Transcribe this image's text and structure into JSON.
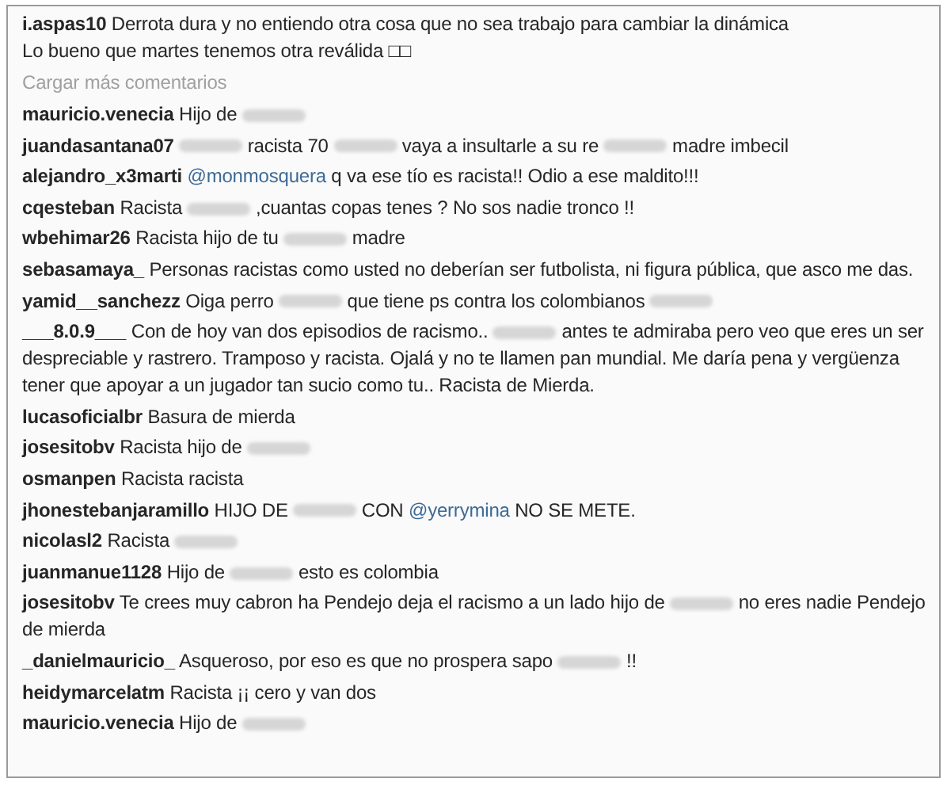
{
  "comments": [
    {
      "username": "i.aspas10",
      "segments": [
        {
          "kind": "text",
          "text": "Derrota dura y no entiendo otra cosa que no sea trabajo para cambiar la dinámica"
        },
        {
          "kind": "break"
        },
        {
          "kind": "text",
          "text": "Lo bueno que martes tenemos otra reválida □□"
        }
      ]
    },
    {
      "kind": "load_more",
      "text": "Cargar más comentarios"
    },
    {
      "username": "mauricio.venecia",
      "segments": [
        {
          "kind": "text",
          "text": "Hijo de"
        },
        {
          "kind": "censored"
        }
      ]
    },
    {
      "username": "juandasantana07",
      "segments": [
        {
          "kind": "censored"
        },
        {
          "kind": "text",
          "text": "racista 70"
        },
        {
          "kind": "censored"
        },
        {
          "kind": "text",
          "text": "vaya a insultarle a su re"
        },
        {
          "kind": "censored"
        },
        {
          "kind": "text",
          "text": "madre imbecil"
        }
      ]
    },
    {
      "username": "alejandro_x3marti",
      "segments": [
        {
          "kind": "mention",
          "text": "@monmosquera"
        },
        {
          "kind": "text",
          "text": "q va ese tío es racista!! Odio a ese maldito!!!"
        }
      ]
    },
    {
      "username": "cqesteban",
      "segments": [
        {
          "kind": "text",
          "text": "Racista"
        },
        {
          "kind": "censored"
        },
        {
          "kind": "text",
          "text": ",cuantas copas tenes ? No sos nadie tronco !!"
        }
      ]
    },
    {
      "username": "wbehimar26",
      "segments": [
        {
          "kind": "text",
          "text": "Racista hijo de tu"
        },
        {
          "kind": "censored"
        },
        {
          "kind": "text",
          "text": "madre"
        }
      ]
    },
    {
      "username": "sebasamaya_",
      "segments": [
        {
          "kind": "text",
          "text": "Personas racistas como usted no deberían ser futbolista, ni figura pública, que asco me das."
        }
      ]
    },
    {
      "username": "yamid__sanchezz",
      "segments": [
        {
          "kind": "text",
          "text": "Oiga perro"
        },
        {
          "kind": "censored"
        },
        {
          "kind": "text",
          "text": "que tiene ps contra los colombianos"
        },
        {
          "kind": "censored"
        }
      ]
    },
    {
      "username": "___8.0.9___",
      "segments": [
        {
          "kind": "text",
          "text": "Con de hoy van dos episodios de racismo.."
        },
        {
          "kind": "censored"
        },
        {
          "kind": "text",
          "text": "antes te admiraba pero veo que eres un ser despreciable y rastrero. Tramposo y racista. Ojalá y no te llamen pan mundial. Me daría pena y vergüenza tener que apoyar a un jugador tan sucio como tu.. Racista de Mierda."
        }
      ]
    },
    {
      "username": "lucasoficialbr",
      "segments": [
        {
          "kind": "text",
          "text": "Basura de mierda"
        }
      ]
    },
    {
      "username": "josesitobv",
      "segments": [
        {
          "kind": "text",
          "text": "Racista hijo de"
        },
        {
          "kind": "censored"
        }
      ]
    },
    {
      "username": "osmanpen",
      "segments": [
        {
          "kind": "text",
          "text": "Racista racista"
        }
      ]
    },
    {
      "username": "jhonestebanjaramillo",
      "segments": [
        {
          "kind": "text",
          "text": "HIJO DE"
        },
        {
          "kind": "censored"
        },
        {
          "kind": "text",
          "text": "CON"
        },
        {
          "kind": "mention",
          "text": "@yerrymina"
        },
        {
          "kind": "text",
          "text": "NO SE METE."
        }
      ]
    },
    {
      "username": "nicolasl2",
      "segments": [
        {
          "kind": "text",
          "text": "Racista"
        },
        {
          "kind": "censored"
        }
      ]
    },
    {
      "username": "juanmanue1128",
      "segments": [
        {
          "kind": "text",
          "text": "Hijo de"
        },
        {
          "kind": "censored"
        },
        {
          "kind": "text",
          "text": "esto es colombia"
        }
      ]
    },
    {
      "username": "josesitobv",
      "segments": [
        {
          "kind": "text",
          "text": "Te crees muy cabron ha Pendejo deja el racismo a un lado hijo de"
        },
        {
          "kind": "censored"
        },
        {
          "kind": "text",
          "text": "no eres nadie Pendejo de mierda"
        }
      ]
    },
    {
      "username": "_danielmauricio_",
      "segments": [
        {
          "kind": "text",
          "text": "Asqueroso, por eso es que no prospera sapo"
        },
        {
          "kind": "censored"
        },
        {
          "kind": "text",
          "text": "!!"
        }
      ]
    },
    {
      "username": "heidymarcelatm",
      "segments": [
        {
          "kind": "text",
          "text": "Racista ¡¡ cero y van dos"
        }
      ]
    },
    {
      "username": "mauricio.venecia",
      "segments": [
        {
          "kind": "text",
          "text": "Hijo de"
        },
        {
          "kind": "censored"
        }
      ]
    }
  ]
}
